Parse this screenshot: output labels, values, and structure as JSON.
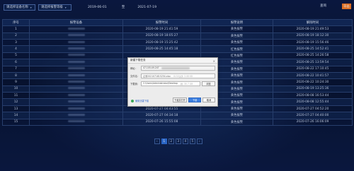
{
  "toolbar": {
    "device_select": "请选择设备名称",
    "type_select": "请选择报警等级",
    "date_from": "2019-06-01",
    "to_label": "至",
    "date_to": "2021-07-19",
    "query_label": "查询",
    "export_label": "导出"
  },
  "table": {
    "headers": [
      "序号",
      "报警设备",
      "报警时间",
      "报警说明",
      "解除时间"
    ],
    "rows": [
      {
        "idx": "1",
        "time": "2020-08-19 21:41:59",
        "desc": "黄色报警",
        "clear": "2020-08-19 21:49:53"
      },
      {
        "idx": "2",
        "time": "2020-08-19 18:05:27",
        "desc": "黄色报警",
        "clear": "2020-08-19 18:12:30"
      },
      {
        "idx": "3",
        "time": "2020-08-19 15:25:42",
        "desc": "黄色报警",
        "clear": "2020-08-19 15:56:46"
      },
      {
        "idx": "4",
        "time": "2020-08-25 14:45:18",
        "desc": "红色报警",
        "clear": "2020-08-25 14:52:41"
      },
      {
        "idx": "5",
        "time": "",
        "desc": "红色报警",
        "clear": "2020-08-25 14:26:58"
      },
      {
        "idx": "6",
        "time": "",
        "desc": "黄色报警",
        "clear": "2020-08-25 13:59:54"
      },
      {
        "idx": "7",
        "time": "",
        "desc": "黄色报警",
        "clear": "2020-08-22 17:10:45"
      },
      {
        "idx": "8",
        "time": "",
        "desc": "黄色报警",
        "clear": "2020-08-22 10:41:57"
      },
      {
        "idx": "9",
        "time": "",
        "desc": "黄色报警",
        "clear": "2020-08-22 10:24:30"
      },
      {
        "idx": "10",
        "time": "",
        "desc": "黄色报警",
        "clear": "2020-08-19 13:25:36"
      },
      {
        "idx": "11",
        "time": "2020-08-08 14:39:45",
        "desc": "黄色报警",
        "clear": "2020-08-08 16:53:44"
      },
      {
        "idx": "12",
        "time": "2020-08-08 02:20:03",
        "desc": "黄色报警",
        "clear": "2020-08-08 12:55:44"
      },
      {
        "idx": "13",
        "time": "2020-07-27 04:43:55",
        "desc": "黄色报警",
        "clear": "2020-07-27 04:52:20"
      },
      {
        "idx": "14",
        "time": "2020-07-27 04:34:18",
        "desc": "黄色报警",
        "clear": "2020-07-27 04:40:00"
      },
      {
        "idx": "15",
        "time": "2020-07-26 15:55:08",
        "desc": "黄色报警",
        "clear": "2020-07-26 16:06:09"
      }
    ]
  },
  "pagination": {
    "prev": "‹",
    "pages": [
      "1",
      "2",
      "3",
      "4",
      "5"
    ],
    "next": "›",
    "current": "1"
  },
  "dialog": {
    "title": "新建下载任务",
    "url_label": "网址：",
    "url_value": "47.105.49.247",
    "name_label": "文件名：",
    "name_value": "记录2021071815254.xlsx",
    "name_size": "XLSX文件 3.06 KB",
    "path_label": "下载到：",
    "path_value": "C:\\Users\\Administrator\\Desktop",
    "path_free": "剩: 35.7 GB",
    "browse_label": "浏览",
    "link_label": "使用迅雷下载",
    "open_label": "下载并打开",
    "download_label": "下载",
    "cancel_label": "取消"
  },
  "colors": {
    "background": "#0a1638",
    "export_button": "#f07a2a",
    "active_page": "#2f6fd6",
    "dialog_primary": "#3c7fe0"
  }
}
